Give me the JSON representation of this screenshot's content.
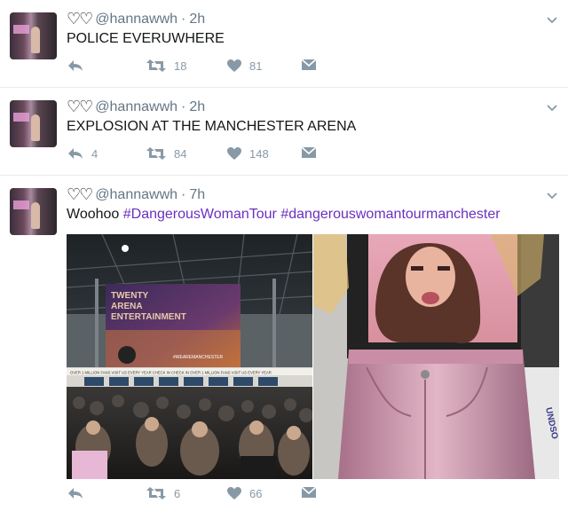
{
  "tweets": [
    {
      "hearts": "♡♡",
      "handle": "@hannawwh",
      "sep": "·",
      "time": "2h",
      "text": "POLICE EVERUWHERE",
      "retweets": "18",
      "likes": "81",
      "replies": ""
    },
    {
      "hearts": "♡♡",
      "handle": "@hannawwh",
      "sep": "·",
      "time": "2h",
      "text": "EXPLOSION AT THE MANCHESTER ARENA",
      "retweets": "84",
      "likes": "148",
      "replies": "4"
    },
    {
      "hearts": "♡♡",
      "handle": "@hannawwh",
      "sep": "·",
      "time": "7h",
      "text_prefix": "Woohoo ",
      "tag1": "#DangerousWomanTour",
      "tag2": "#dangerouswomantourmanchester",
      "retweets": "6",
      "likes": "66",
      "replies": ""
    }
  ],
  "photo1": {
    "sign_line1": "TWENTY",
    "sign_line2": "ARENA",
    "sign_line3": "ENTERTAINMENT",
    "hashtag": "#WEAREMANCHESTER",
    "banner": "OVER 1 MILLION FANS VISIT US EVERY YEAR   CHECK IN   CHECK IN   OVER 1 MILLION FANS VISIT US EVERY YEAR"
  },
  "photo2": {
    "bag_text": "UNDSO"
  },
  "colors": {
    "accent": "#6a2fbf",
    "icon": "#8899a6",
    "divider": "#e6ecf0"
  },
  "icons": [
    "reply-icon",
    "retweet-icon",
    "like-icon",
    "message-icon",
    "chevron-down-icon"
  ]
}
